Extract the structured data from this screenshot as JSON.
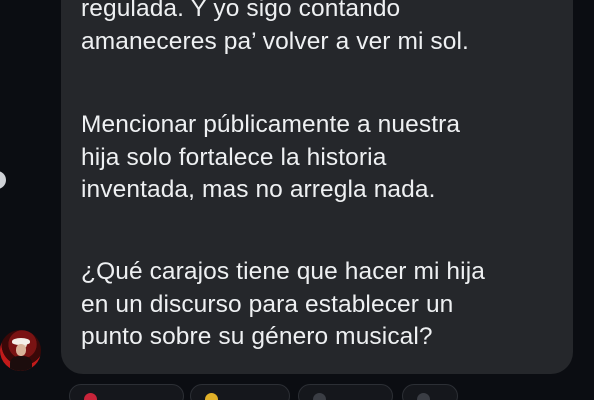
{
  "message": {
    "paragraphs": [
      {
        "lines": [
          "regulada. Y yo sigo contando",
          "amaneceres pa’ volver a ver mi sol."
        ]
      },
      {
        "lines": [
          "Mencionar públicamente a nuestra",
          "hija solo fortalece la historia",
          "inventada, mas no arregla nada."
        ]
      },
      {
        "lines": [
          "¿Qué carajos tiene que hacer mi hija",
          "en un discurso para establecer un",
          "punto sobre su género musical?"
        ]
      }
    ]
  },
  "reactions": [
    {
      "icon": "heart-icon",
      "color": "#c8243a"
    },
    {
      "icon": "emoji-icon",
      "color": "#e0b028"
    },
    {
      "icon": "reaction-icon",
      "color": "#3a3d44"
    },
    {
      "icon": "reaction-icon",
      "color": "#3a3d44"
    }
  ],
  "colors": {
    "background": "#0b0d12",
    "bubble": "#25272b",
    "text": "#eef0f2"
  }
}
